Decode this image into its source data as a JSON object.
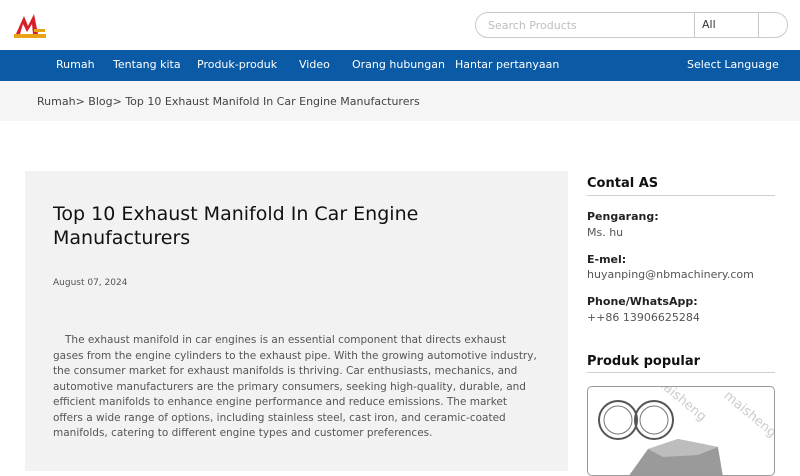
{
  "header": {
    "search_placeholder": "Search Products",
    "search_scope": "All"
  },
  "nav": {
    "items": [
      "Rumah",
      "Tentang kita",
      "Produk-produk",
      "Video",
      "Orang hubungan",
      "Hantar pertanyaan"
    ],
    "language": "Select Language"
  },
  "breadcrumb": {
    "home": "Rumah",
    "sep1": ">",
    "blog": "Blog",
    "sep2": ">",
    "current": "Top 10 Exhaust Manifold In Car Engine Manufacturers"
  },
  "article": {
    "title": "Top 10 Exhaust Manifold In Car Engine Manufacturers",
    "date": "August 07, 2024",
    "body": "The exhaust manifold in car engines is an essential component that directs exhaust gases from the engine cylinders to the exhaust pipe. With the growing automotive industry, the consumer market for exhaust manifolds is thriving. Car enthusiasts, mechanics, and automotive manufacturers are the primary consumers, seeking high-quality, durable, and efficient manifolds to enhance engine performance and reduce emissions. The market offers a wide range of options, including stainless steel, cast iron, and ceramic-coated manifolds, catering to different engine types and customer preferences."
  },
  "sidebar": {
    "contact_heading": "Contal AS",
    "author_label": "Pengarang:",
    "author_value": "Ms. hu",
    "email_label": "E-mel:",
    "email_value": "huyanping@nbmachinery.com",
    "phone_label": "Phone/WhatsApp:",
    "phone_value": "++86 13906625284",
    "popular_heading": "Produk popular",
    "watermark": "maisheng"
  },
  "colors": {
    "nav_bg": "#0b5aa5",
    "logo_red": "#d81e2a",
    "logo_gold": "#e8a317"
  }
}
